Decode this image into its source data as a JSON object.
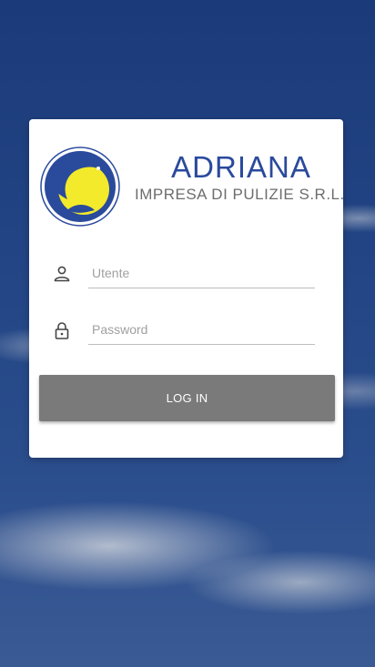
{
  "brand": {
    "name": "ADRIANA",
    "subtitle": "IMPRESA DI PULIZIE S.R.L.",
    "logo_icon": "dolphin-logo-icon",
    "name_color": "#2a4a9c"
  },
  "form": {
    "username": {
      "placeholder": "Utente",
      "value": "",
      "icon": "user-icon"
    },
    "password": {
      "placeholder": "Password",
      "value": "",
      "icon": "lock-icon"
    },
    "login_label": "LOG IN",
    "button_color": "#7a7a7a"
  }
}
